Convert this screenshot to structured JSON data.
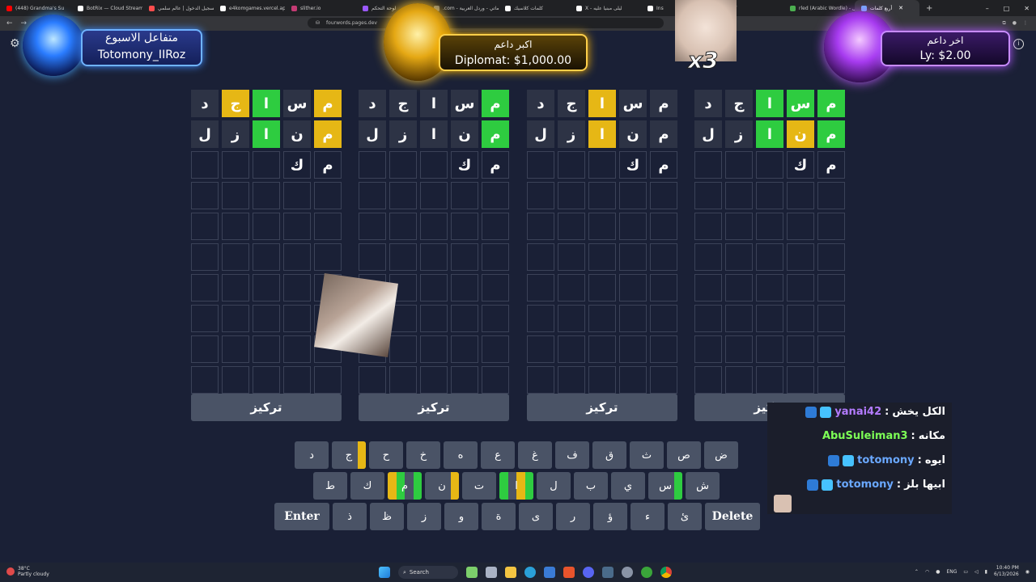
{
  "browser": {
    "tabs": [
      {
        "title": "(448) Grandma's Su",
        "color": "#ff0000"
      },
      {
        "title": "BotRix — Cloud Streaming",
        "color": "#ffffff"
      },
      {
        "title": "تسجيل الدخول | عالم سلمي",
        "color": "#ff4d4d"
      },
      {
        "title": "e4komgames.vercel.app/ga",
        "color": "#ffffff"
      },
      {
        "title": "slither.io",
        "color": "#c43b74"
      },
      {
        "title": "لوحة التحكم",
        "color": "#9b59ff"
      },
      {
        "title": ".com - كلماتي - وردل العربية",
        "color": "#777777"
      },
      {
        "title": "كلمات كلاسيك",
        "color": "#ffffff"
      },
      {
        "title": "X - ليلى مبنيا عليه",
        "color": "#ffffff"
      },
      {
        "title": "Ins",
        "color": "#ffffff"
      },
      {
        "title": "كلمة",
        "color": "#ffffff"
      },
      {
        "title": "rled (Arabic Wordle) - الوردل",
        "color": "#4caf50"
      },
      {
        "title": "أربع كلمات",
        "color": "#6ab0ff"
      }
    ],
    "url": "fourwords.pages.dev",
    "new_tab": "+"
  },
  "overlays": {
    "left": {
      "title": "متفاعل الاسبوع",
      "name": "Totomony_IIRoz"
    },
    "center": {
      "title": "اكبر داعم",
      "name": "Diplomat: $1,000.00"
    },
    "right": {
      "title": "اخر داعم",
      "name": "Ly: $2.00"
    },
    "multiplier": "x3"
  },
  "boards": [
    {
      "rows": [
        [
          {
            "l": "م",
            "s": "yellow"
          },
          {
            "l": "س",
            "s": "filled"
          },
          {
            "l": "ا",
            "s": "green"
          },
          {
            "l": "ج",
            "s": "yellow"
          },
          {
            "l": "د",
            "s": "filled"
          }
        ],
        [
          {
            "l": "م",
            "s": "yellow"
          },
          {
            "l": "ن",
            "s": "filled"
          },
          {
            "l": "ا",
            "s": "green"
          },
          {
            "l": "ز",
            "s": "filled"
          },
          {
            "l": "ل",
            "s": "filled"
          }
        ],
        [
          {
            "l": "م",
            "s": "typed"
          },
          {
            "l": "ك",
            "s": "typed"
          },
          {
            "l": "",
            "s": "empty"
          },
          {
            "l": "",
            "s": "empty"
          },
          {
            "l": "",
            "s": "empty"
          }
        ]
      ],
      "focus": "تركيز"
    },
    {
      "rows": [
        [
          {
            "l": "م",
            "s": "green"
          },
          {
            "l": "س",
            "s": "filled"
          },
          {
            "l": "ا",
            "s": "filled"
          },
          {
            "l": "ج",
            "s": "filled"
          },
          {
            "l": "د",
            "s": "filled"
          }
        ],
        [
          {
            "l": "م",
            "s": "green"
          },
          {
            "l": "ن",
            "s": "filled"
          },
          {
            "l": "ا",
            "s": "filled"
          },
          {
            "l": "ز",
            "s": "filled"
          },
          {
            "l": "ل",
            "s": "filled"
          }
        ],
        [
          {
            "l": "م",
            "s": "typed"
          },
          {
            "l": "ك",
            "s": "typed"
          },
          {
            "l": "",
            "s": "empty"
          },
          {
            "l": "",
            "s": "empty"
          },
          {
            "l": "",
            "s": "empty"
          }
        ]
      ],
      "focus": "تركيز"
    },
    {
      "rows": [
        [
          {
            "l": "م",
            "s": "filled"
          },
          {
            "l": "س",
            "s": "filled"
          },
          {
            "l": "ا",
            "s": "yellow"
          },
          {
            "l": "ج",
            "s": "filled"
          },
          {
            "l": "د",
            "s": "filled"
          }
        ],
        [
          {
            "l": "م",
            "s": "filled"
          },
          {
            "l": "ن",
            "s": "filled"
          },
          {
            "l": "ا",
            "s": "yellow"
          },
          {
            "l": "ز",
            "s": "filled"
          },
          {
            "l": "ل",
            "s": "filled"
          }
        ],
        [
          {
            "l": "م",
            "s": "typed"
          },
          {
            "l": "ك",
            "s": "typed"
          },
          {
            "l": "",
            "s": "empty"
          },
          {
            "l": "",
            "s": "empty"
          },
          {
            "l": "",
            "s": "empty"
          }
        ]
      ],
      "focus": "تركيز"
    },
    {
      "rows": [
        [
          {
            "l": "م",
            "s": "green"
          },
          {
            "l": "س",
            "s": "green"
          },
          {
            "l": "ا",
            "s": "green"
          },
          {
            "l": "ج",
            "s": "filled"
          },
          {
            "l": "د",
            "s": "filled"
          }
        ],
        [
          {
            "l": "م",
            "s": "green"
          },
          {
            "l": "ن",
            "s": "yellow"
          },
          {
            "l": "ا",
            "s": "green"
          },
          {
            "l": "ز",
            "s": "filled"
          },
          {
            "l": "ل",
            "s": "filled"
          }
        ],
        [
          {
            "l": "م",
            "s": "typed"
          },
          {
            "l": "ك",
            "s": "typed"
          },
          {
            "l": "",
            "s": "empty"
          },
          {
            "l": "",
            "s": "empty"
          },
          {
            "l": "",
            "s": "empty"
          }
        ]
      ],
      "focus": "تركيز"
    }
  ],
  "total_rows": 10,
  "keyboard": {
    "row1": [
      {
        "l": "ض"
      },
      {
        "l": "ص"
      },
      {
        "l": "ث"
      },
      {
        "l": "ق"
      },
      {
        "l": "ف"
      },
      {
        "l": "غ"
      },
      {
        "l": "ع"
      },
      {
        "l": "ه"
      },
      {
        "l": "خ"
      },
      {
        "l": "ح"
      },
      {
        "l": "ج",
        "q": [
          "#e6b715",
          "",
          "",
          ""
        ]
      },
      {
        "l": "د"
      }
    ],
    "row2": [
      {
        "l": "ش"
      },
      {
        "l": "س",
        "q": [
          "#2ecc40",
          "",
          "",
          ""
        ]
      },
      {
        "l": "ي"
      },
      {
        "l": "ب"
      },
      {
        "l": "ل"
      },
      {
        "l": "ا",
        "q": [
          "#2ecc40",
          "#e6b715",
          "",
          "#2ecc40"
        ]
      },
      {
        "l": "ت"
      },
      {
        "l": "ن",
        "q": [
          "#e6b715",
          "",
          "",
          ""
        ]
      },
      {
        "l": "م",
        "q": [
          "#2ecc40",
          "",
          "#2ecc40",
          "#e6b715"
        ]
      },
      {
        "l": "ك"
      },
      {
        "l": "ط"
      }
    ],
    "row3": [
      {
        "l": "Delete",
        "wide": true
      },
      {
        "l": "ئ"
      },
      {
        "l": "ء"
      },
      {
        "l": "ؤ"
      },
      {
        "l": "ر"
      },
      {
        "l": "ى"
      },
      {
        "l": "ة"
      },
      {
        "l": "و"
      },
      {
        "l": "ز"
      },
      {
        "l": "ظ"
      },
      {
        "l": "ذ"
      },
      {
        "l": "Enter",
        "wide": true
      }
    ]
  },
  "chat": [
    {
      "user": "yanai42",
      "msg": "الكل يخش",
      "color": "#b37bff"
    },
    {
      "user": "AbuSuleiman3",
      "msg": "مكانه",
      "color": "#7dff56"
    },
    {
      "user": "totomony",
      "msg": "ايوه",
      "color": "#6aa8ff"
    },
    {
      "user": "totomony",
      "msg": "ابيها بلز",
      "color": "#6aa8ff"
    }
  ],
  "taskbar": {
    "weather_temp": "38°C",
    "weather_desc": "Partly cloudy",
    "search": "Search",
    "lang": "ENG",
    "time": "10:40 PM",
    "date": "6/13/2026"
  },
  "colors": {
    "green": "#2ecc40",
    "yellow": "#e6b715",
    "bg": "#1a2036",
    "key": "#4a5366"
  }
}
